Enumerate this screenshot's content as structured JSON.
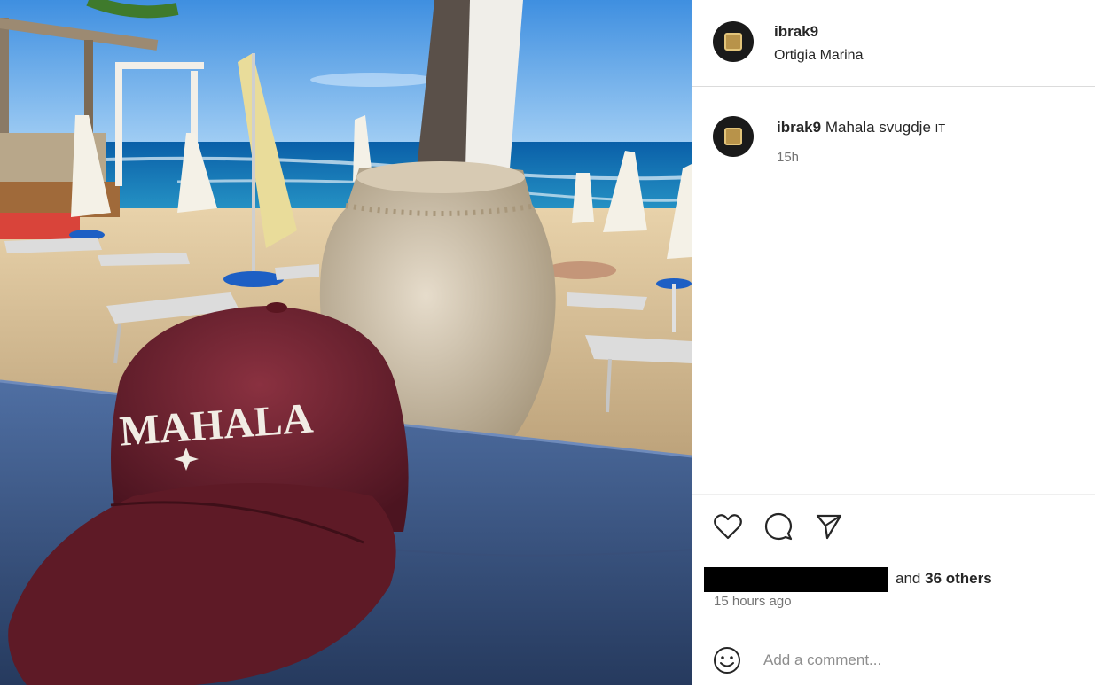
{
  "post": {
    "image": {
      "subject": "Maroon baseball cap with MAHALA lettering on a wooden table, clay amphora and beach with umbrellas and sea behind",
      "cap_text": "MAHALA"
    },
    "header": {
      "username": "ibrak9",
      "location": "Ortigia Marina",
      "avatar_icon": "crest-avatar-icon"
    },
    "caption": {
      "username": "ibrak9",
      "text": "Mahala svugdje",
      "flag": "IT",
      "time": "15h"
    },
    "actions": {
      "like_icon": "heart-icon",
      "comment_icon": "comment-icon",
      "share_icon": "send-icon"
    },
    "likes": {
      "and_text": "and",
      "others": "36 others"
    },
    "timestamp": "15 hours ago",
    "comment": {
      "emoji_icon": "smiley-icon",
      "placeholder": "Add a comment..."
    }
  },
  "colors": {
    "text": "#262626",
    "muted": "#737373",
    "divider": "#dbdbdb",
    "cap": "#6e1f2c"
  }
}
